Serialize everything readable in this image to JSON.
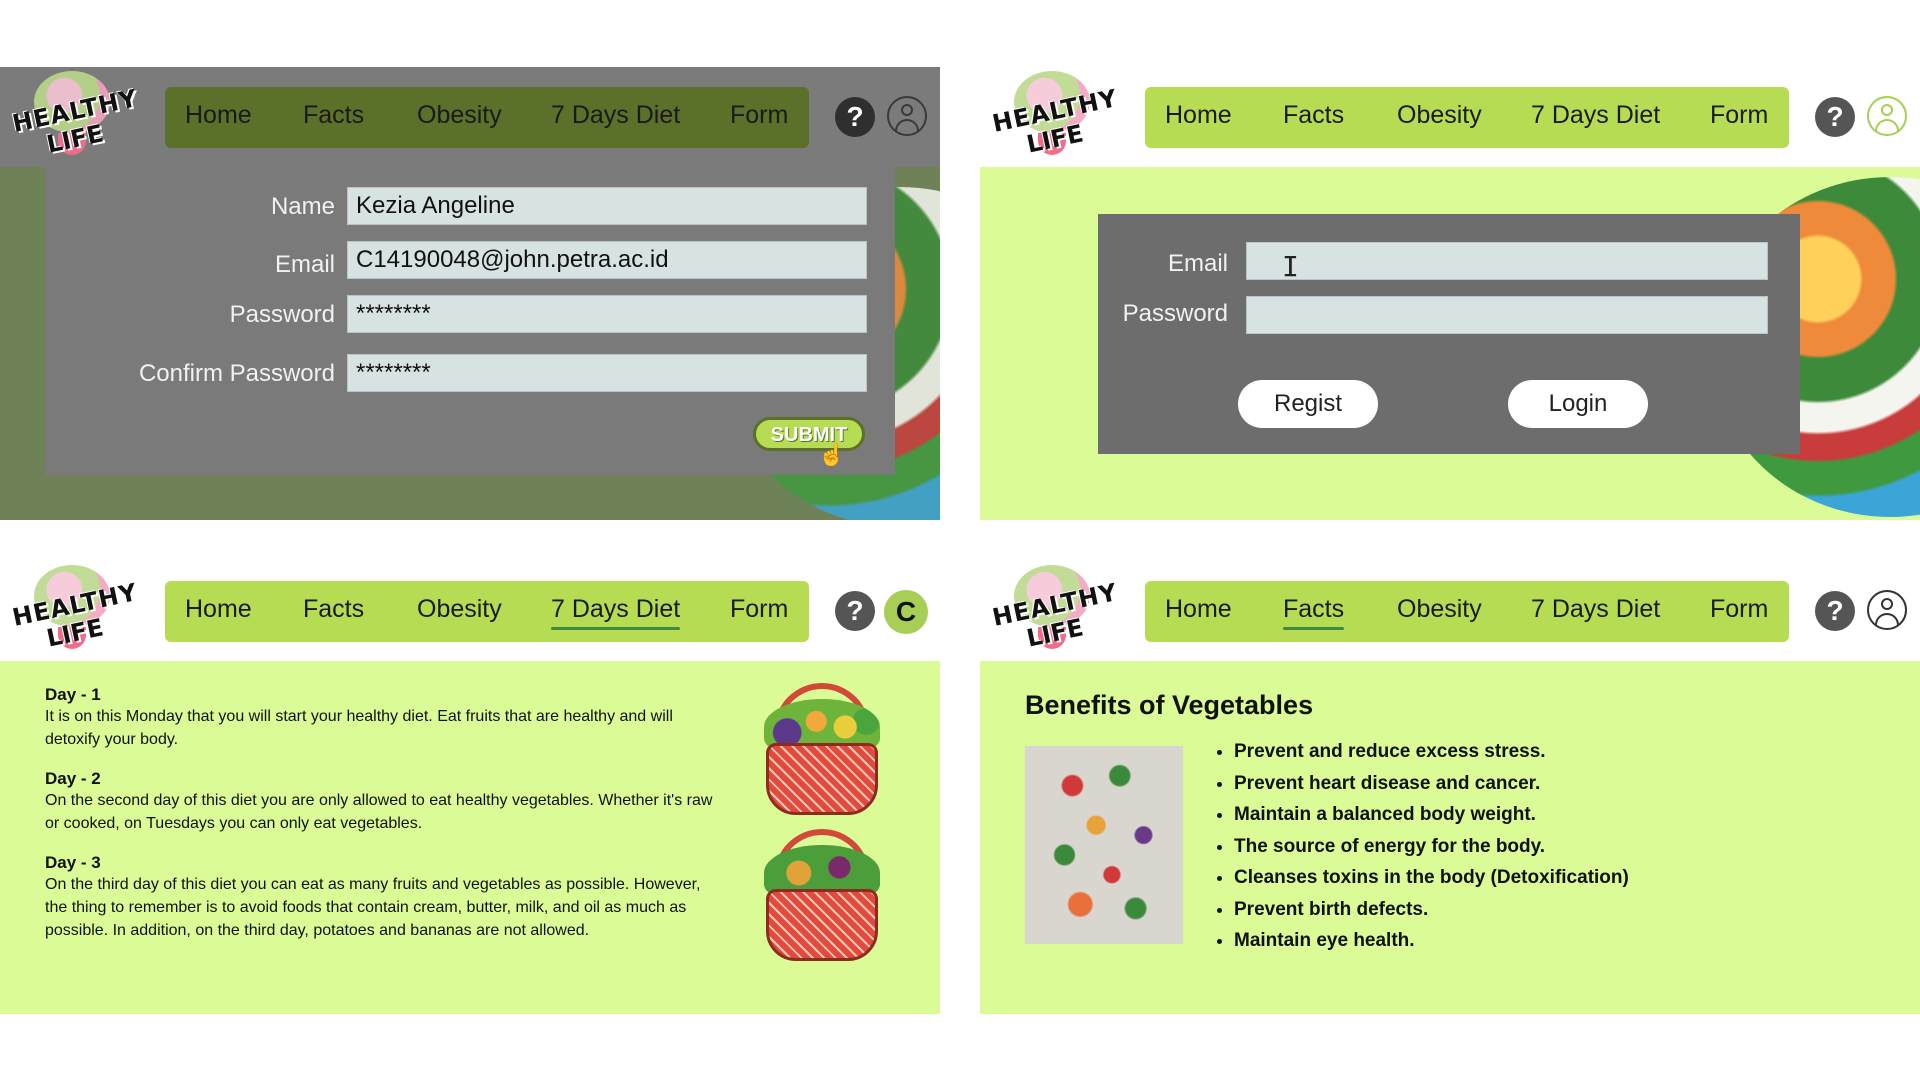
{
  "brand": {
    "logo_line1": "HEALTHY",
    "logo_line2": "LIFE"
  },
  "nav": [
    "Home",
    "Facts",
    "Obesity",
    "7 Days Diet",
    "Form"
  ],
  "icons": {
    "help": "question-mark-circle",
    "user": "user-circle"
  },
  "colors": {
    "nav_green": "#b5dc52",
    "page_green": "#dafb96",
    "dark_nav": "#5b7029",
    "form_gray": "#7a7a7a"
  },
  "register_form": {
    "fields": [
      {
        "label": "Name",
        "value": "Kezia Angeline"
      },
      {
        "label": "Email",
        "value": "C14190048@john.petra.ac.id"
      },
      {
        "label": "Password",
        "value": "********"
      },
      {
        "label": "Confirm Password",
        "value": "********"
      }
    ],
    "submit_label": "SUBMIT"
  },
  "login_form": {
    "email_label": "Email",
    "password_label": "Password",
    "email_value": "",
    "password_value": "",
    "regist_label": "Regist",
    "login_label": "Login"
  },
  "avatar_initial": "C",
  "diet": [
    {
      "title": "Day - 1",
      "text": "It is on this Monday that you will start your healthy diet. Eat fruits that are healthy and will detoxify your body."
    },
    {
      "title": "Day - 2",
      "text": "On the second day of this diet you are only allowed to eat healthy vegetables. Whether it's raw or cooked, on Tuesdays you can only eat vegetables."
    },
    {
      "title": "Day - 3",
      "text": "On the third day of this diet you can eat as many fruits and vegetables as possible. However, the thing to remember is to avoid foods that contain cream, butter, milk, and oil as much as possible. In addition, on the third day, potatoes and bananas are not allowed."
    }
  ],
  "facts": {
    "title": "Benefits of Vegetables",
    "items": [
      "Prevent and reduce excess stress.",
      "Prevent heart disease and cancer.",
      "Maintain a balanced body weight.",
      "The source of energy for the body.",
      "Cleanses toxins in the body (Detoxification)",
      "Prevent birth defects.",
      "Maintain eye health."
    ]
  }
}
